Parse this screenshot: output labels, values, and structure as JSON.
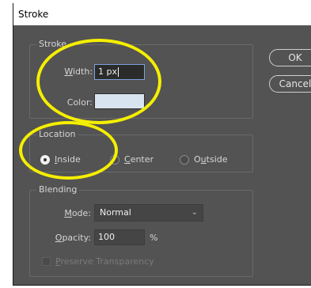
{
  "dialog": {
    "title": "Stroke"
  },
  "stroke": {
    "group_title": "Stroke",
    "width_label_u": "W",
    "width_label_rest": "idth:",
    "width_value": "1 px",
    "color_label": "Color:",
    "color_value": "#d8e4f0"
  },
  "location": {
    "group_title": "Location",
    "options": [
      {
        "u": "I",
        "rest": "nside",
        "selected": true
      },
      {
        "u": "C",
        "rest": "enter",
        "selected": false
      },
      {
        "pre": "O",
        "u": "u",
        "rest": "tside",
        "selected": false
      }
    ]
  },
  "blending": {
    "group_title": "Blending",
    "mode_label_u": "M",
    "mode_label_rest": "ode:",
    "mode_value": "Normal",
    "opacity_label_u": "O",
    "opacity_label_rest": "pacity:",
    "opacity_value": "100",
    "opacity_unit": "%",
    "preserve_u": "P",
    "preserve_rest": "reserve Transparency"
  },
  "buttons": {
    "ok": "OK",
    "cancel": "Cancel"
  },
  "colors": {
    "highlight": "#f5ef00",
    "panel": "#535353",
    "focus": "#7ca2d8"
  }
}
